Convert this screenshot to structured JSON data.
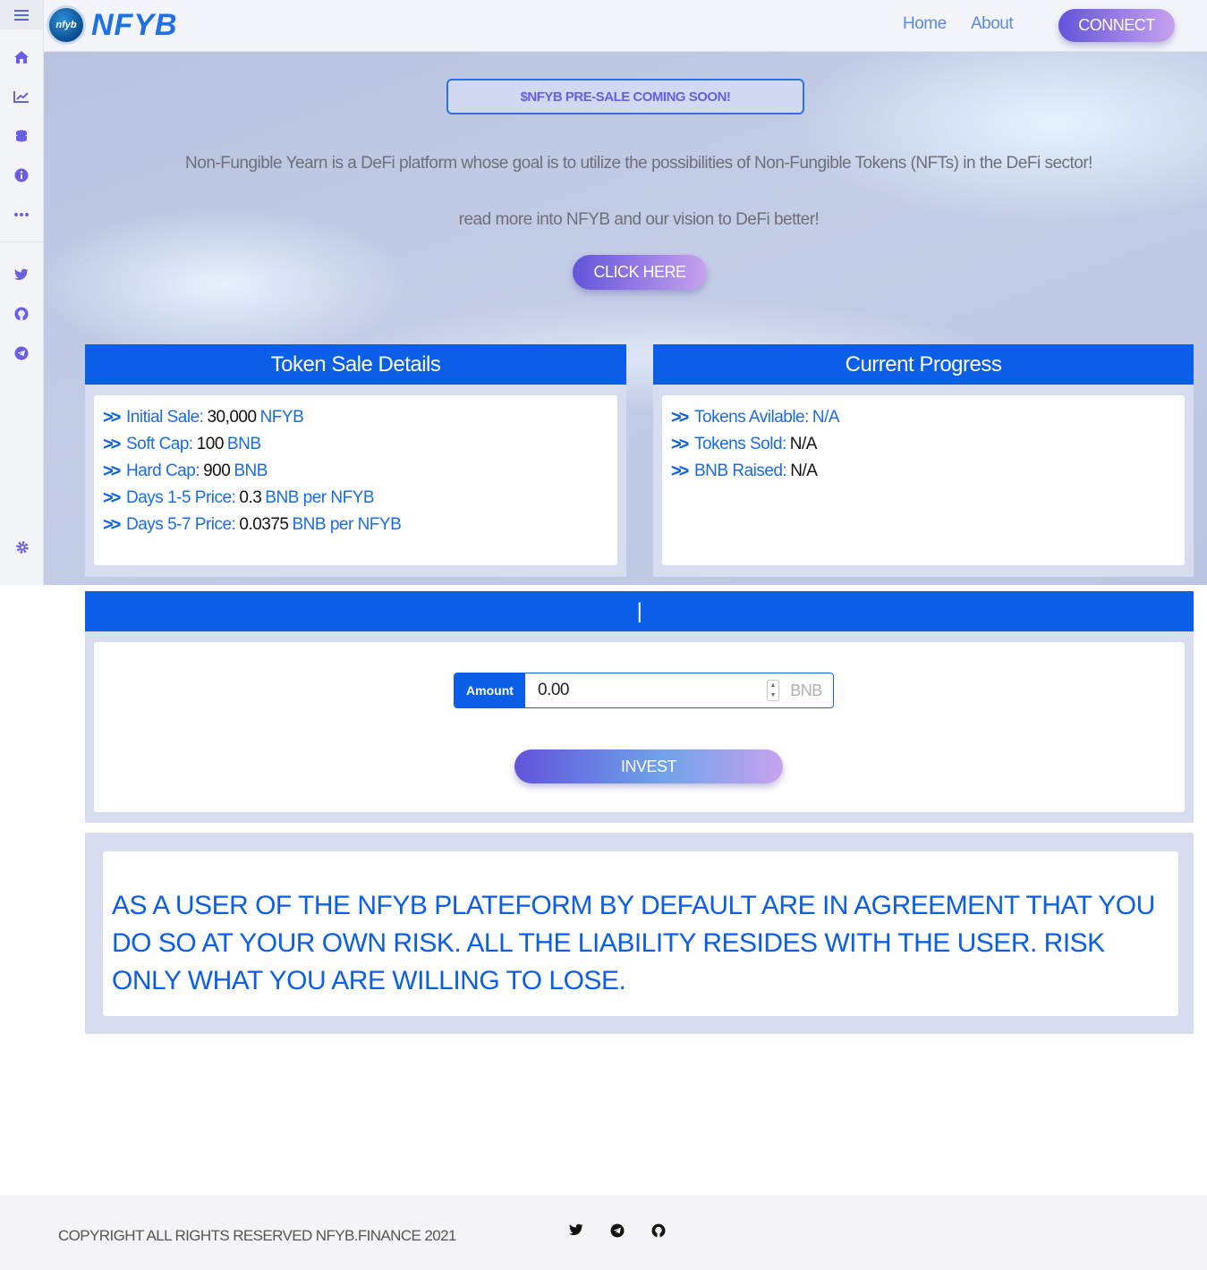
{
  "brand": {
    "name": "NFYB",
    "logo_mark": "nfyb"
  },
  "nav": {
    "home": "Home",
    "about": "About",
    "connect": "CONNECT"
  },
  "sidebar": {
    "items": [
      "menu-icon",
      "home-icon",
      "chart-line-icon",
      "coins-icon",
      "info-icon",
      "more-icon",
      "twitter-icon",
      "github-icon",
      "telegram-icon",
      "settings-icon"
    ]
  },
  "hero": {
    "banner": "$NFYB PRE-SALE COMING SOON!",
    "description": "Non-Fungible Yearn is a DeFi platform whose goal is to utilize the possibilities of Non-Fungible Tokens (NFTs) in the DeFi sector!",
    "read_more": "read more into NFYB and our vision to DeFi better!",
    "cta": "CLICK HERE"
  },
  "token_sale": {
    "title": "Token Sale Details",
    "rows": [
      {
        "label": "Initial Sale:",
        "value": "30,000",
        "unit": "NFYB"
      },
      {
        "label": "Soft Cap:",
        "value": "100",
        "unit": "BNB"
      },
      {
        "label": "Hard Cap:",
        "value": "900",
        "unit": "BNB"
      },
      {
        "label": "Days 1-5 Price:",
        "value": "0.3",
        "unit": "BNB per NFYB"
      },
      {
        "label": "Days 5-7 Price:",
        "value": "0.0375",
        "unit": "BNB per NFYB"
      }
    ]
  },
  "progress": {
    "title": "Current Progress",
    "rows": [
      {
        "label": "Tokens Avilable:",
        "value": "N/A"
      },
      {
        "label": "Tokens Sold:",
        "value": "N/A"
      },
      {
        "label": "BNB Raised:",
        "value": "N/A"
      }
    ]
  },
  "invest": {
    "header": "|",
    "amount_label": "Amount",
    "amount_value": "0.00",
    "unit": "BNB",
    "button": "INVEST"
  },
  "disclaimer": "AS A USER OF THE NFYB PLATEFORM BY DEFAULT ARE IN AGREEMENT THAT YOU DO SO AT YOUR OWN RISK. ALL THE LIABILITY RESIDES WITH THE USER. RISK ONLY WHAT YOU ARE WILLING TO LOSE.",
  "footer": {
    "copyright": "COPYRIGHT ALL RIGHTS RESERVED NFYB.FINANCE 2021",
    "icons": [
      "twitter-icon",
      "telegram-icon",
      "github-icon"
    ]
  },
  "colors": {
    "primary": "#0b5fe6",
    "gradient_start": "#6254da",
    "gradient_end": "#c8a2ef"
  }
}
